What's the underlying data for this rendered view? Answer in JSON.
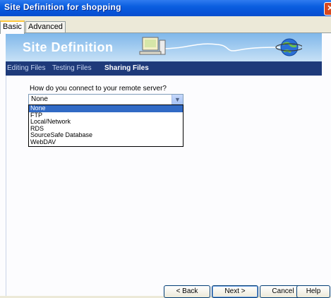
{
  "window": {
    "title": "Site Definition for shopping",
    "close_icon": "close-icon"
  },
  "tabs": [
    {
      "label": "Basic",
      "active": true
    },
    {
      "label": "Advanced",
      "active": false
    }
  ],
  "banner": {
    "title": "Site Definition"
  },
  "subnav": {
    "items": [
      {
        "label": "Editing Files"
      },
      {
        "label": "Testing Files"
      },
      {
        "label": "Sharing Files"
      }
    ],
    "active_index": 2
  },
  "main": {
    "question": "How do you connect to your remote server?",
    "select_value": "None",
    "options": [
      "None",
      "FTP",
      "Local/Network",
      "RDS",
      "SourceSafe Database",
      "WebDAV"
    ],
    "selected_index": 0
  },
  "buttons": {
    "back": "< Back",
    "next": "Next >",
    "cancel": "Cancel",
    "help": "Help"
  }
}
